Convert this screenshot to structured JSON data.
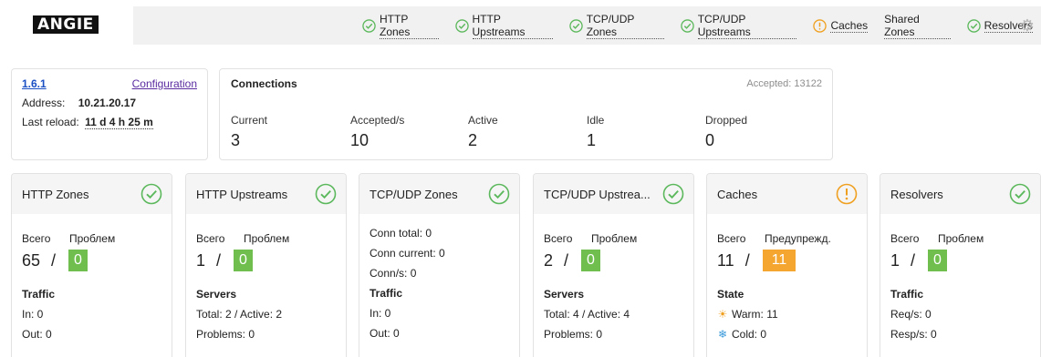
{
  "header": {
    "logo": "ANGIE",
    "nav": [
      {
        "label": "HTTP Zones",
        "icon": "check-circle-icon",
        "status": "ok"
      },
      {
        "label": "HTTP Upstreams",
        "icon": "check-circle-icon",
        "status": "ok"
      },
      {
        "label": "TCP/UDP Zones",
        "icon": "check-circle-icon",
        "status": "ok"
      },
      {
        "label": "TCP/UDP Upstreams",
        "icon": "check-circle-icon",
        "status": "ok"
      },
      {
        "label": "Caches",
        "icon": "warning-circle-icon",
        "status": "warning"
      },
      {
        "label": "Shared Zones",
        "icon": "",
        "status": "none"
      },
      {
        "label": "Resolvers",
        "icon": "check-circle-icon",
        "status": "ok"
      }
    ],
    "settings_icon": "gear-icon"
  },
  "info": {
    "version": "1.6.1",
    "config_link": "Configuration",
    "address_label": "Address:",
    "address": "10.21.20.17",
    "reload_label": "Last reload:",
    "reload": "11 d 4 h 25 m"
  },
  "connections": {
    "title": "Connections",
    "accepted": "Accepted: 13122",
    "stats": [
      {
        "label": "Current",
        "value": "3"
      },
      {
        "label": "Accepted/s",
        "value": "10"
      },
      {
        "label": "Active",
        "value": "2"
      },
      {
        "label": "Idle",
        "value": "1"
      },
      {
        "label": "Dropped",
        "value": "0"
      }
    ]
  },
  "cards": {
    "http_zones": {
      "title": "HTTP Zones",
      "status": "ok",
      "total_label": "Всего",
      "problem_label": "Проблем",
      "total": "65",
      "sep": "/",
      "problems": "0",
      "section": "Traffic",
      "line1": "In: 0",
      "line2": "Out: 0"
    },
    "http_upstreams": {
      "title": "HTTP Upstreams",
      "status": "ok",
      "total_label": "Всего",
      "problem_label": "Проблем",
      "total": "1",
      "sep": "/",
      "problems": "0",
      "section": "Servers",
      "line1": "Total: 2 / Active: 2",
      "line2": "Problems: 0"
    },
    "tcp_zones": {
      "title": "TCP/UDP Zones",
      "status": "ok",
      "conn_total": "Conn total: 0",
      "conn_current": "Conn current: 0",
      "conn_rate": "Conn/s: 0",
      "section": "Traffic",
      "line1": "In: 0",
      "line2": "Out: 0"
    },
    "tcp_upstreams": {
      "title": "TCP/UDP Upstrea...",
      "status": "ok",
      "total_label": "Всего",
      "problem_label": "Проблем",
      "total": "2",
      "sep": "/",
      "problems": "0",
      "section": "Servers",
      "line1": "Total: 4 / Active: 4",
      "line2": "Problems: 0"
    },
    "caches": {
      "title": "Caches",
      "status": "warning",
      "total_label": "Всего",
      "problem_label": "Предупрежд.",
      "total": "11",
      "sep": "/",
      "problems": "11",
      "section": "State",
      "line1": "Warm: 11",
      "line2": "Cold: 0"
    },
    "resolvers": {
      "title": "Resolvers",
      "status": "ok",
      "total_label": "Всего",
      "problem_label": "Проблем",
      "total": "1",
      "sep": "/",
      "problems": "0",
      "section": "Traffic",
      "line1": "Req/s: 0",
      "line2": "Resp/s: 0"
    }
  },
  "colors": {
    "ok": "#5cb85c",
    "warning": "#f0a020",
    "badge_ok": "#6fbe4e",
    "badge_warn": "#f4a630",
    "link": "#1a4fc4"
  }
}
